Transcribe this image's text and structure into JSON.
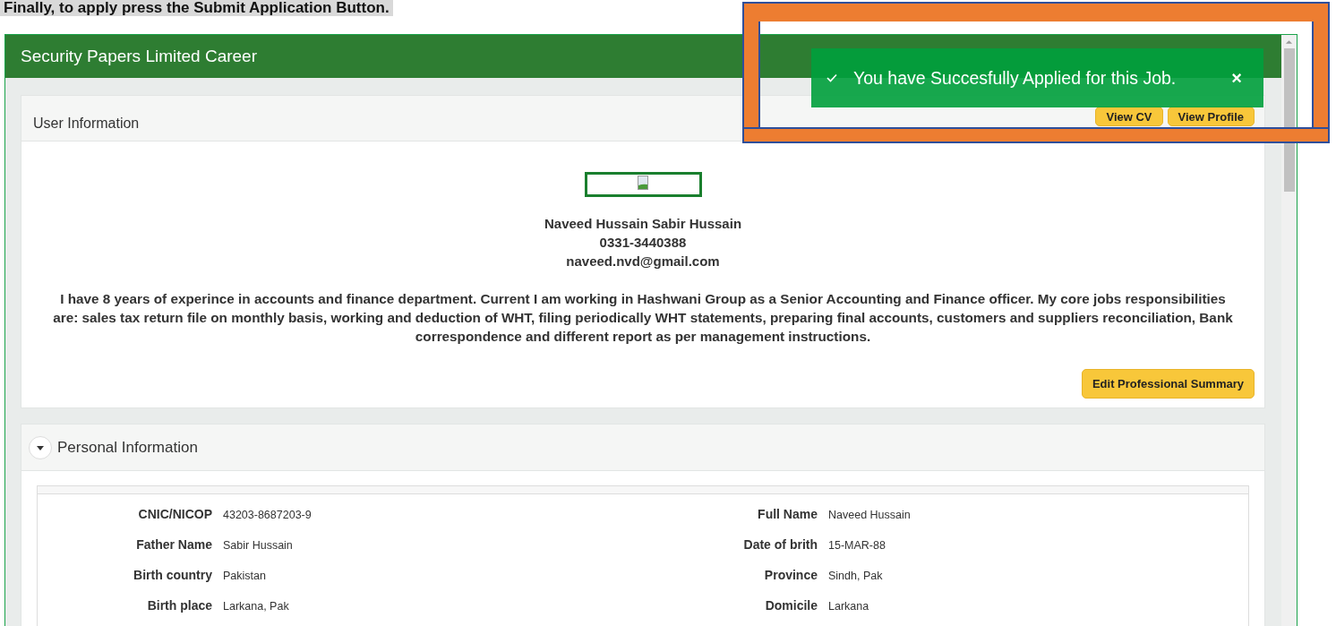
{
  "instruction": "Finally, to apply press the Submit Application Button.",
  "app": {
    "title": "Security Papers Limited Career"
  },
  "toast": {
    "message": "You have Succesfully Applied for this Job.",
    "close": "×"
  },
  "user_information": {
    "title": "User Information",
    "buttons": [
      "View CV",
      "View Profile"
    ],
    "name": "Naveed Hussain Sabir Hussain",
    "phone": "0331-3440388",
    "email": "naveed.nvd@gmail.com",
    "summary": "I have 8 years of experince in accounts and finance department. Current I am working in Hashwani Group as a Senior Accounting and Finance officer. My core jobs responsibilities are: sales tax return file on monthly basis, working and deduction of WHT, filing periodically WHT statements, preparing final accounts, customers and suppliers reconciliation, Bank correspondence and different report as per management instructions.",
    "edit_button": "Edit Professional Summary"
  },
  "personal_information": {
    "title": "Personal Information",
    "expanded": true,
    "fields": [
      {
        "label": "CNIC/NICOP",
        "value": "43203-8687203-9"
      },
      {
        "label": "Full Name",
        "value": "Naveed Hussain"
      },
      {
        "label": "Father Name",
        "value": "Sabir Hussain"
      },
      {
        "label": "Date of brith",
        "value": "15-MAR-88"
      },
      {
        "label": "Birth country",
        "value": "Pakistan"
      },
      {
        "label": "Province",
        "value": "Sindh, Pak"
      },
      {
        "label": "Birth place",
        "value": "Larkana, Pak"
      },
      {
        "label": "Domicile",
        "value": "Larkana"
      }
    ]
  }
}
